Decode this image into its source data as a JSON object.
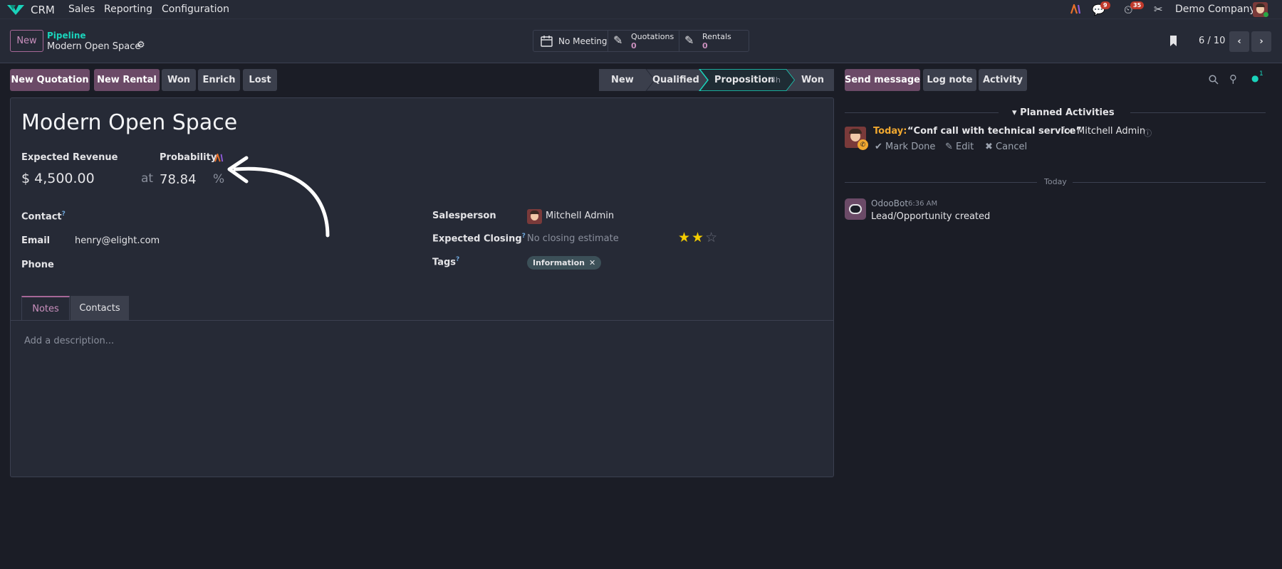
{
  "topnav": {
    "app": "CRM",
    "menu": [
      "Sales",
      "Reporting",
      "Configuration"
    ],
    "messages_count": "9",
    "activities_count": "35",
    "company": "Demo Company"
  },
  "control": {
    "new_label": "New",
    "breadcrumb_parent": "Pipeline",
    "breadcrumb_current": "Modern Open Space",
    "smart_meeting": "No Meeting",
    "smart_quotations_label": "Quotations",
    "smart_quotations_count": "0",
    "smart_rentals_label": "Rentals",
    "smart_rentals_count": "0",
    "pager": "6 / 10"
  },
  "actions": [
    "New Quotation",
    "New Rental",
    "Won",
    "Enrich",
    "Lost"
  ],
  "stages": {
    "new": "New",
    "qualified": "Qualified",
    "proposition": "Proposition",
    "proposition_time": "8h",
    "won": "Won"
  },
  "chatter_buttons": {
    "send": "Send message",
    "log": "Log note",
    "activity": "Activity",
    "followers": "1"
  },
  "form": {
    "title": "Modern Open Space",
    "revenue_label": "Expected Revenue",
    "revenue": "$ 4,500.00",
    "at": "at",
    "probability_label": "Probability",
    "probability": "78.84",
    "percent": "%",
    "contact_label": "Contact",
    "email_label": "Email",
    "email": "henry@elight.com",
    "phone_label": "Phone",
    "salesperson_label": "Salesperson",
    "salesperson": "Mitchell Admin",
    "closing_label": "Expected Closing",
    "closing_placeholder": "No closing estimate",
    "priority_stars": 2,
    "tags_label": "Tags",
    "tag": "Information",
    "tabs": [
      "Notes",
      "Contacts"
    ],
    "description_placeholder": "Add a description..."
  },
  "chatter": {
    "planned_title": "Planned Activities",
    "today_label": "Today:",
    "activity_summary": "“Conf call with technical service”",
    "activity_for": "for Mitchell Admin",
    "mark_done": "Mark Done",
    "edit": "Edit",
    "cancel": "Cancel",
    "divider": "Today",
    "author": "OdooBot",
    "time": "6:36 AM",
    "message": "Lead/Opportunity created"
  },
  "colors": {
    "accent_teal": "#1ad3bb",
    "primary_button": "#6b4a67",
    "star": "#f3cc00"
  }
}
